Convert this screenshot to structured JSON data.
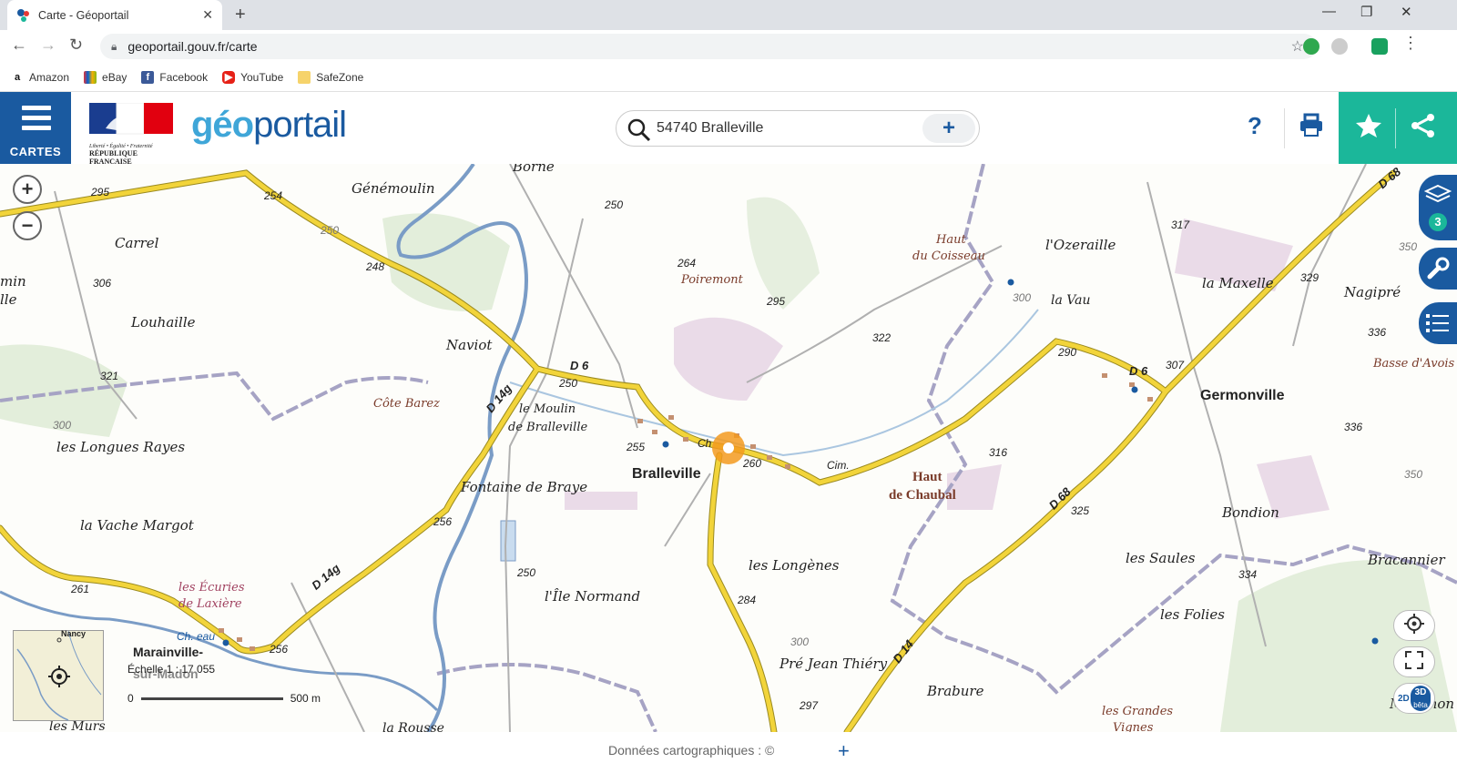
{
  "browser": {
    "tab_title": "Carte - Géoportail",
    "url": "geoportail.gouv.fr/carte",
    "bookmarks": [
      "Amazon",
      "eBay",
      "Facebook",
      "YouTube",
      "SafeZone"
    ]
  },
  "header": {
    "menu_label": "CARTES",
    "logo_text_geo": "géo",
    "logo_text_portail": "portail",
    "marianne_line1": "Liberté • Égalité • Fraternité",
    "marianne_line2": "RÉPUBLIQUE FRANÇAISE",
    "search_value": "54740 Bralleville",
    "help_label": "?"
  },
  "map": {
    "places": [
      "Borne",
      "Génémoulin",
      "Carrel",
      "Louhaille",
      "Naviot",
      "Côte Barez",
      "les Longues Rayes",
      "la Vache Margot",
      "Fontaine de Braye",
      "le Moulin",
      "de Bralleville",
      "Bralleville",
      "Poiremont",
      "Haut",
      "du Coisseau",
      "l'Ozeraille",
      "la Vau",
      "la Maxelle",
      "Nagipré",
      "Basse d'Avois",
      "Germonville",
      "Bondion",
      "Bracannier",
      "les Saules",
      "les Folies",
      "les Longènes",
      "l'Île Normand",
      "Pré Jean Thiéry",
      "Brabure",
      "Malomon",
      "Haut",
      "de Chaubal",
      "les Écuries",
      "de Laxière",
      "Marainville-",
      "sur-Madon",
      "les Murs",
      "la Rousse",
      "les Grandes",
      "Vignes",
      "Cim.",
      "Ch. eau",
      "Ch",
      "min",
      "lle"
    ],
    "altitudes": [
      "295",
      "254",
      "248",
      "306",
      "321",
      "250",
      "264",
      "295",
      "322",
      "317",
      "329",
      "336",
      "307",
      "290",
      "336",
      "316",
      "325",
      "334",
      "260",
      "255",
      "250",
      "256",
      "284",
      "261",
      "256",
      "250",
      "297",
      "300",
      "300",
      "350",
      "350",
      "300",
      "250"
    ],
    "roads": [
      "D 6",
      "D 14g",
      "D 14g",
      "D 68",
      "D 68",
      "D 14",
      "D 6"
    ],
    "scale_label": "Échelle 1 : 17 055",
    "scale_start": "0",
    "scale_end": "500 m",
    "minimap_label": "Nancy",
    "mode_2d": "2D",
    "mode_3d": "3D",
    "mode_3d_sub": "bêta",
    "layers_count": "3"
  },
  "footer": {
    "attribution": "Données cartographiques : ©"
  },
  "colors": {
    "brand_blue": "#1a5aa0",
    "teal": "#1bb79a",
    "road_yellow": "#f2d43a",
    "river": "#7a9cc6",
    "marker_orange": "#f39a1e"
  }
}
